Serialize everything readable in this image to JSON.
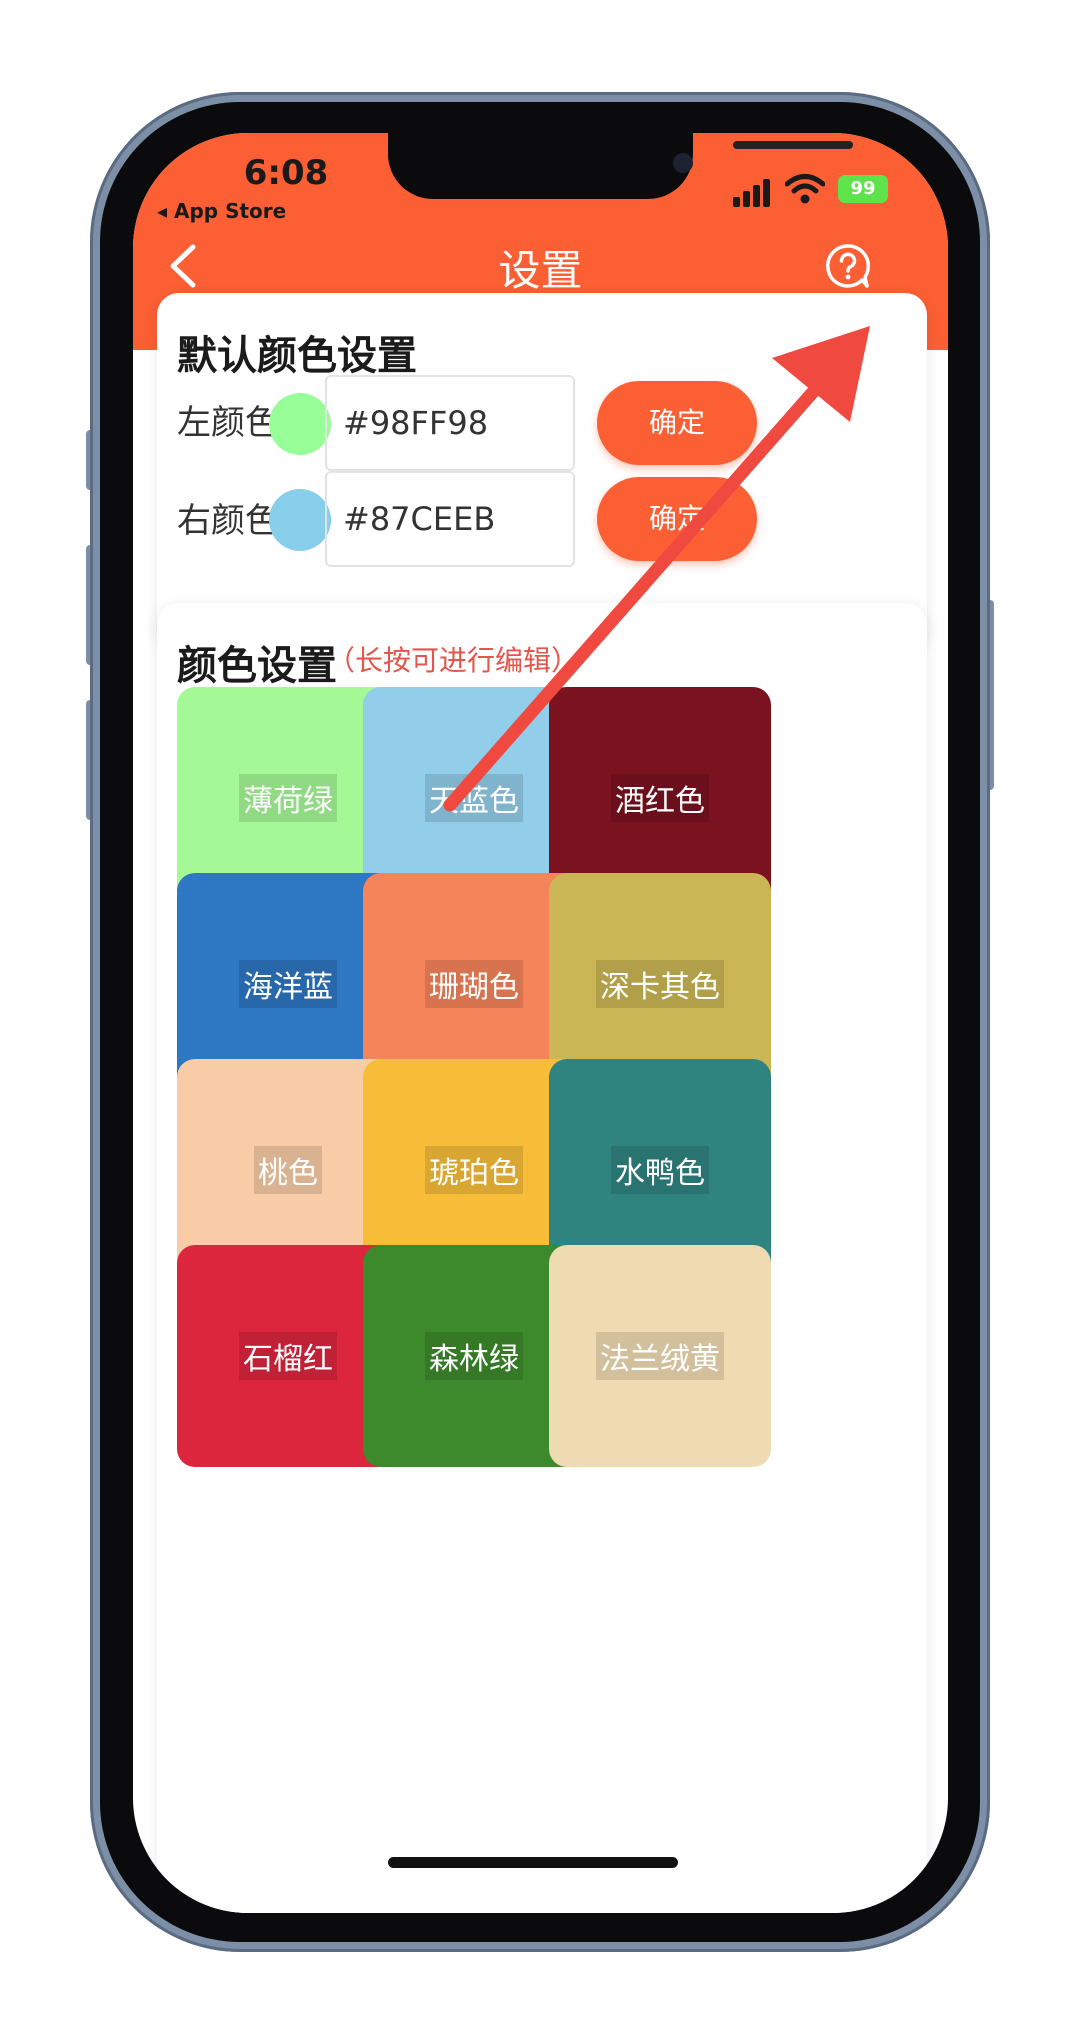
{
  "status_bar": {
    "time": "6:08",
    "back_app": "◂ App Store",
    "battery": "99"
  },
  "nav": {
    "title": "设置",
    "back_icon": "chevron-left-icon",
    "help_icon": "question-circle-icon"
  },
  "default_colors": {
    "title": "默认颜色设置",
    "rows": [
      {
        "label": "左颜色",
        "color": "#98FF98",
        "value": "#98FF98",
        "button": "确定"
      },
      {
        "label": "右颜色",
        "color": "#87CEEB",
        "value": "#87CEEB",
        "button": "确定"
      }
    ]
  },
  "color_settings": {
    "title": "颜色设置",
    "hint": "（长按可进行编辑）",
    "swatches": [
      {
        "name": "薄荷绿",
        "color": "#a4f996"
      },
      {
        "name": "天蓝色",
        "color": "#92cde9"
      },
      {
        "name": "酒红色",
        "color": "#7b1220"
      },
      {
        "name": "海洋蓝",
        "color": "#2e77c2"
      },
      {
        "name": "珊瑚色",
        "color": "#f5845a"
      },
      {
        "name": "深卡其色",
        "color": "#cbb655"
      },
      {
        "name": "桃色",
        "color": "#f8cca6"
      },
      {
        "name": "琥珀色",
        "color": "#f7bd38"
      },
      {
        "name": "水鸭色",
        "color": "#2f8480"
      },
      {
        "name": "石榴红",
        "color": "#dc263e"
      },
      {
        "name": "森林绿",
        "color": "#3d8a2d"
      },
      {
        "name": "法兰绒黄",
        "color": "#efdbb2"
      }
    ]
  },
  "colors": {
    "accent": "#fc5f34",
    "annotation_arrow": "#f0493f"
  }
}
